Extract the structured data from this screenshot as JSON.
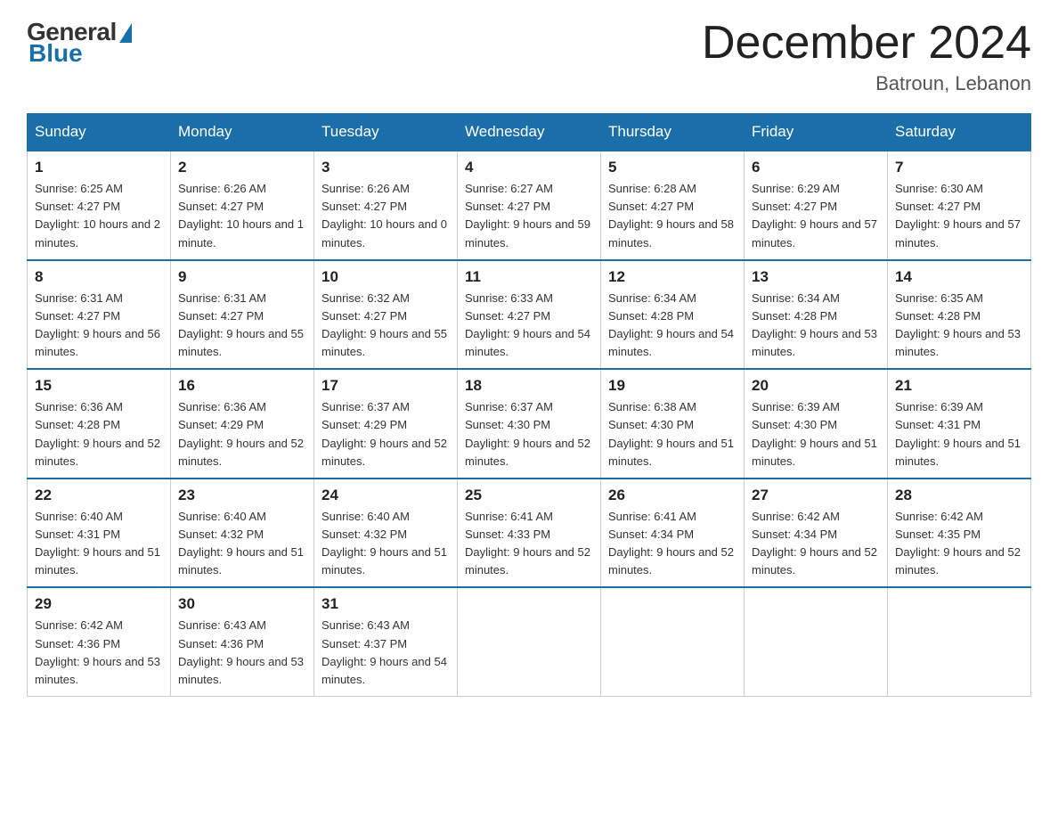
{
  "header": {
    "logo_general": "General",
    "logo_blue": "Blue",
    "month_title": "December 2024",
    "location": "Batroun, Lebanon"
  },
  "days_of_week": [
    "Sunday",
    "Monday",
    "Tuesday",
    "Wednesday",
    "Thursday",
    "Friday",
    "Saturday"
  ],
  "weeks": [
    [
      {
        "day": "1",
        "sunrise": "6:25 AM",
        "sunset": "4:27 PM",
        "daylight": "10 hours and 2 minutes."
      },
      {
        "day": "2",
        "sunrise": "6:26 AM",
        "sunset": "4:27 PM",
        "daylight": "10 hours and 1 minute."
      },
      {
        "day": "3",
        "sunrise": "6:26 AM",
        "sunset": "4:27 PM",
        "daylight": "10 hours and 0 minutes."
      },
      {
        "day": "4",
        "sunrise": "6:27 AM",
        "sunset": "4:27 PM",
        "daylight": "9 hours and 59 minutes."
      },
      {
        "day": "5",
        "sunrise": "6:28 AM",
        "sunset": "4:27 PM",
        "daylight": "9 hours and 58 minutes."
      },
      {
        "day": "6",
        "sunrise": "6:29 AM",
        "sunset": "4:27 PM",
        "daylight": "9 hours and 57 minutes."
      },
      {
        "day": "7",
        "sunrise": "6:30 AM",
        "sunset": "4:27 PM",
        "daylight": "9 hours and 57 minutes."
      }
    ],
    [
      {
        "day": "8",
        "sunrise": "6:31 AM",
        "sunset": "4:27 PM",
        "daylight": "9 hours and 56 minutes."
      },
      {
        "day": "9",
        "sunrise": "6:31 AM",
        "sunset": "4:27 PM",
        "daylight": "9 hours and 55 minutes."
      },
      {
        "day": "10",
        "sunrise": "6:32 AM",
        "sunset": "4:27 PM",
        "daylight": "9 hours and 55 minutes."
      },
      {
        "day": "11",
        "sunrise": "6:33 AM",
        "sunset": "4:27 PM",
        "daylight": "9 hours and 54 minutes."
      },
      {
        "day": "12",
        "sunrise": "6:34 AM",
        "sunset": "4:28 PM",
        "daylight": "9 hours and 54 minutes."
      },
      {
        "day": "13",
        "sunrise": "6:34 AM",
        "sunset": "4:28 PM",
        "daylight": "9 hours and 53 minutes."
      },
      {
        "day": "14",
        "sunrise": "6:35 AM",
        "sunset": "4:28 PM",
        "daylight": "9 hours and 53 minutes."
      }
    ],
    [
      {
        "day": "15",
        "sunrise": "6:36 AM",
        "sunset": "4:28 PM",
        "daylight": "9 hours and 52 minutes."
      },
      {
        "day": "16",
        "sunrise": "6:36 AM",
        "sunset": "4:29 PM",
        "daylight": "9 hours and 52 minutes."
      },
      {
        "day": "17",
        "sunrise": "6:37 AM",
        "sunset": "4:29 PM",
        "daylight": "9 hours and 52 minutes."
      },
      {
        "day": "18",
        "sunrise": "6:37 AM",
        "sunset": "4:30 PM",
        "daylight": "9 hours and 52 minutes."
      },
      {
        "day": "19",
        "sunrise": "6:38 AM",
        "sunset": "4:30 PM",
        "daylight": "9 hours and 51 minutes."
      },
      {
        "day": "20",
        "sunrise": "6:39 AM",
        "sunset": "4:30 PM",
        "daylight": "9 hours and 51 minutes."
      },
      {
        "day": "21",
        "sunrise": "6:39 AM",
        "sunset": "4:31 PM",
        "daylight": "9 hours and 51 minutes."
      }
    ],
    [
      {
        "day": "22",
        "sunrise": "6:40 AM",
        "sunset": "4:31 PM",
        "daylight": "9 hours and 51 minutes."
      },
      {
        "day": "23",
        "sunrise": "6:40 AM",
        "sunset": "4:32 PM",
        "daylight": "9 hours and 51 minutes."
      },
      {
        "day": "24",
        "sunrise": "6:40 AM",
        "sunset": "4:32 PM",
        "daylight": "9 hours and 51 minutes."
      },
      {
        "day": "25",
        "sunrise": "6:41 AM",
        "sunset": "4:33 PM",
        "daylight": "9 hours and 52 minutes."
      },
      {
        "day": "26",
        "sunrise": "6:41 AM",
        "sunset": "4:34 PM",
        "daylight": "9 hours and 52 minutes."
      },
      {
        "day": "27",
        "sunrise": "6:42 AM",
        "sunset": "4:34 PM",
        "daylight": "9 hours and 52 minutes."
      },
      {
        "day": "28",
        "sunrise": "6:42 AM",
        "sunset": "4:35 PM",
        "daylight": "9 hours and 52 minutes."
      }
    ],
    [
      {
        "day": "29",
        "sunrise": "6:42 AM",
        "sunset": "4:36 PM",
        "daylight": "9 hours and 53 minutes."
      },
      {
        "day": "30",
        "sunrise": "6:43 AM",
        "sunset": "4:36 PM",
        "daylight": "9 hours and 53 minutes."
      },
      {
        "day": "31",
        "sunrise": "6:43 AM",
        "sunset": "4:37 PM",
        "daylight": "9 hours and 54 minutes."
      },
      null,
      null,
      null,
      null
    ]
  ]
}
